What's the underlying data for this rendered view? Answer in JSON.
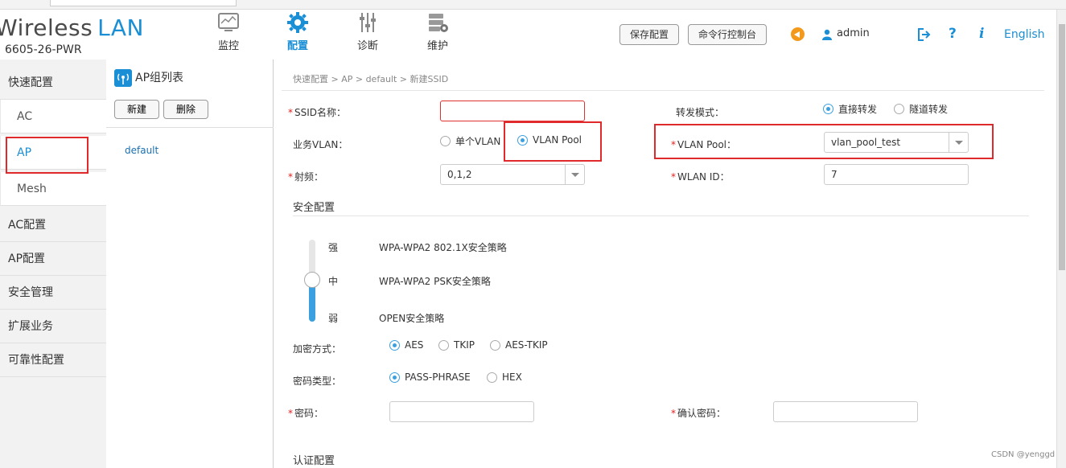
{
  "header": {
    "brand_prefix": "Wireless",
    "brand_suffix": "LAN",
    "model": "6605-26-PWR",
    "nav": [
      {
        "label": "监控",
        "icon": "monitor-icon"
      },
      {
        "label": "配置",
        "icon": "gear-icon"
      },
      {
        "label": "诊断",
        "icon": "sliders-icon"
      },
      {
        "label": "维护",
        "icon": "maintenance-icon"
      }
    ],
    "save_config": "保存配置",
    "cli_console": "命令行控制台",
    "user": "admin",
    "help": "?",
    "info": "i",
    "language": "English"
  },
  "sidebar": {
    "items": [
      "快速配置",
      "AC",
      "AP",
      "Mesh",
      "AC配置",
      "AP配置",
      "安全管理",
      "扩展业务",
      "可靠性配置"
    ]
  },
  "ap_group": {
    "title": "AP组列表",
    "new_button": "新建",
    "delete_button": "删除",
    "items": [
      "default"
    ]
  },
  "main": {
    "breadcrumb": "快速配置 > AP > default > 新建SSID",
    "ssid_label": "SSID名称：",
    "ssid_value": "",
    "forward_label": "转发模式：",
    "forward_options": [
      "直接转发",
      "隧道转发"
    ],
    "forward_selected": "直接转发",
    "vlan_label": "业务VLAN：",
    "vlan_options": [
      "单个VLAN",
      "VLAN Pool"
    ],
    "vlan_selected": "VLAN Pool",
    "vlan_pool_label": "VLAN Pool：",
    "vlan_pool_value": "vlan_pool_test",
    "radio_freq_label": "射频：",
    "radio_freq_value": "0,1,2",
    "wlan_id_label": "WLAN ID：",
    "wlan_id_value": "7",
    "security_section": "安全配置",
    "security_levels": [
      {
        "level": "强",
        "policy": "WPA-WPA2 802.1X安全策略"
      },
      {
        "level": "中",
        "policy": "WPA-WPA2 PSK安全策略"
      },
      {
        "level": "弱",
        "policy": "OPEN安全策略"
      }
    ],
    "security_selected_level": "中",
    "encryption_label": "加密方式：",
    "encryption_options": [
      "AES",
      "TKIP",
      "AES-TKIP"
    ],
    "encryption_selected": "AES",
    "pwd_type_label": "密码类型：",
    "pwd_type_options": [
      "PASS-PHRASE",
      "HEX"
    ],
    "pwd_type_selected": "PASS-PHRASE",
    "password_label": "密码：",
    "password_value": "",
    "confirm_password_label": "确认密码：",
    "confirm_password_value": "",
    "auth_section": "认证配置"
  },
  "watermark": "CSDN @yenggd",
  "colors": {
    "accent": "#1a8fd6",
    "highlight_box": "#e0292b",
    "required": "#e02020",
    "sidebar_bg": "#f2f2f2"
  }
}
